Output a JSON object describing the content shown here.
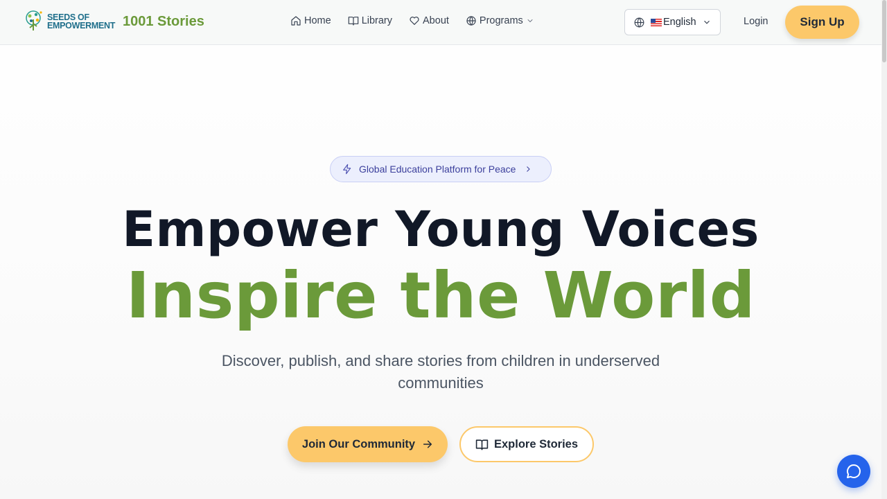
{
  "header": {
    "logo_text_line1": "SEEDS OF",
    "logo_text_line2": "EMPOWERMENT",
    "brand": "1001 Stories",
    "nav": [
      {
        "label": "Home",
        "icon": "home-icon"
      },
      {
        "label": "Library",
        "icon": "book-icon"
      },
      {
        "label": "About",
        "icon": "heart-icon"
      },
      {
        "label": "Programs",
        "icon": "globe-icon",
        "dropdown": true
      }
    ],
    "language": {
      "selected": "English",
      "flag": "us-flag"
    },
    "login_label": "Login",
    "signup_label": "Sign Up"
  },
  "hero": {
    "badge_text": "Global Education Platform for Peace",
    "title_line1": "Empower Young Voices",
    "title_line2": "Inspire the World",
    "subtitle": "Discover, publish, and share stories from children in underserved communities",
    "primary_cta": "Join Our Community",
    "secondary_cta": "Explore Stories"
  },
  "colors": {
    "brand_green": "#6b9a3a",
    "cta_yellow": "#fcc86a",
    "badge_bg": "#eceffd",
    "chat_blue": "#2563eb"
  }
}
